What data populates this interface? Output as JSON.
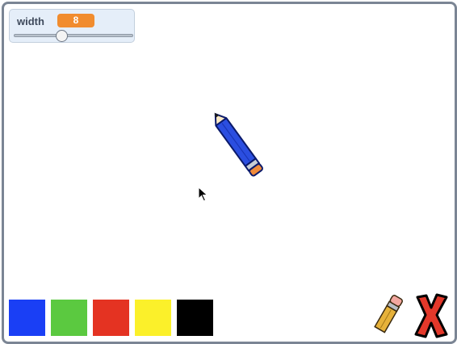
{
  "slider": {
    "label": "width",
    "value": "8",
    "level": 0.4
  },
  "palette": [
    {
      "name": "blue",
      "color": "#1a3ff5"
    },
    {
      "name": "green",
      "color": "#5bc940"
    },
    {
      "name": "red",
      "color": "#e43322"
    },
    {
      "name": "yellow",
      "color": "#fbf02a"
    },
    {
      "name": "black",
      "color": "#000000"
    }
  ],
  "icons": {
    "pencil": "pencil-icon",
    "cursor": "mouse-pointer-icon",
    "eraser": "eraser-icon",
    "clear": "clear-x-icon"
  },
  "colors": {
    "pencil_body": "#2b4ee0",
    "pencil_eraser": "#f08a3a",
    "slider_value_bg": "#f18c2e",
    "stage_border": "#7b8594"
  }
}
